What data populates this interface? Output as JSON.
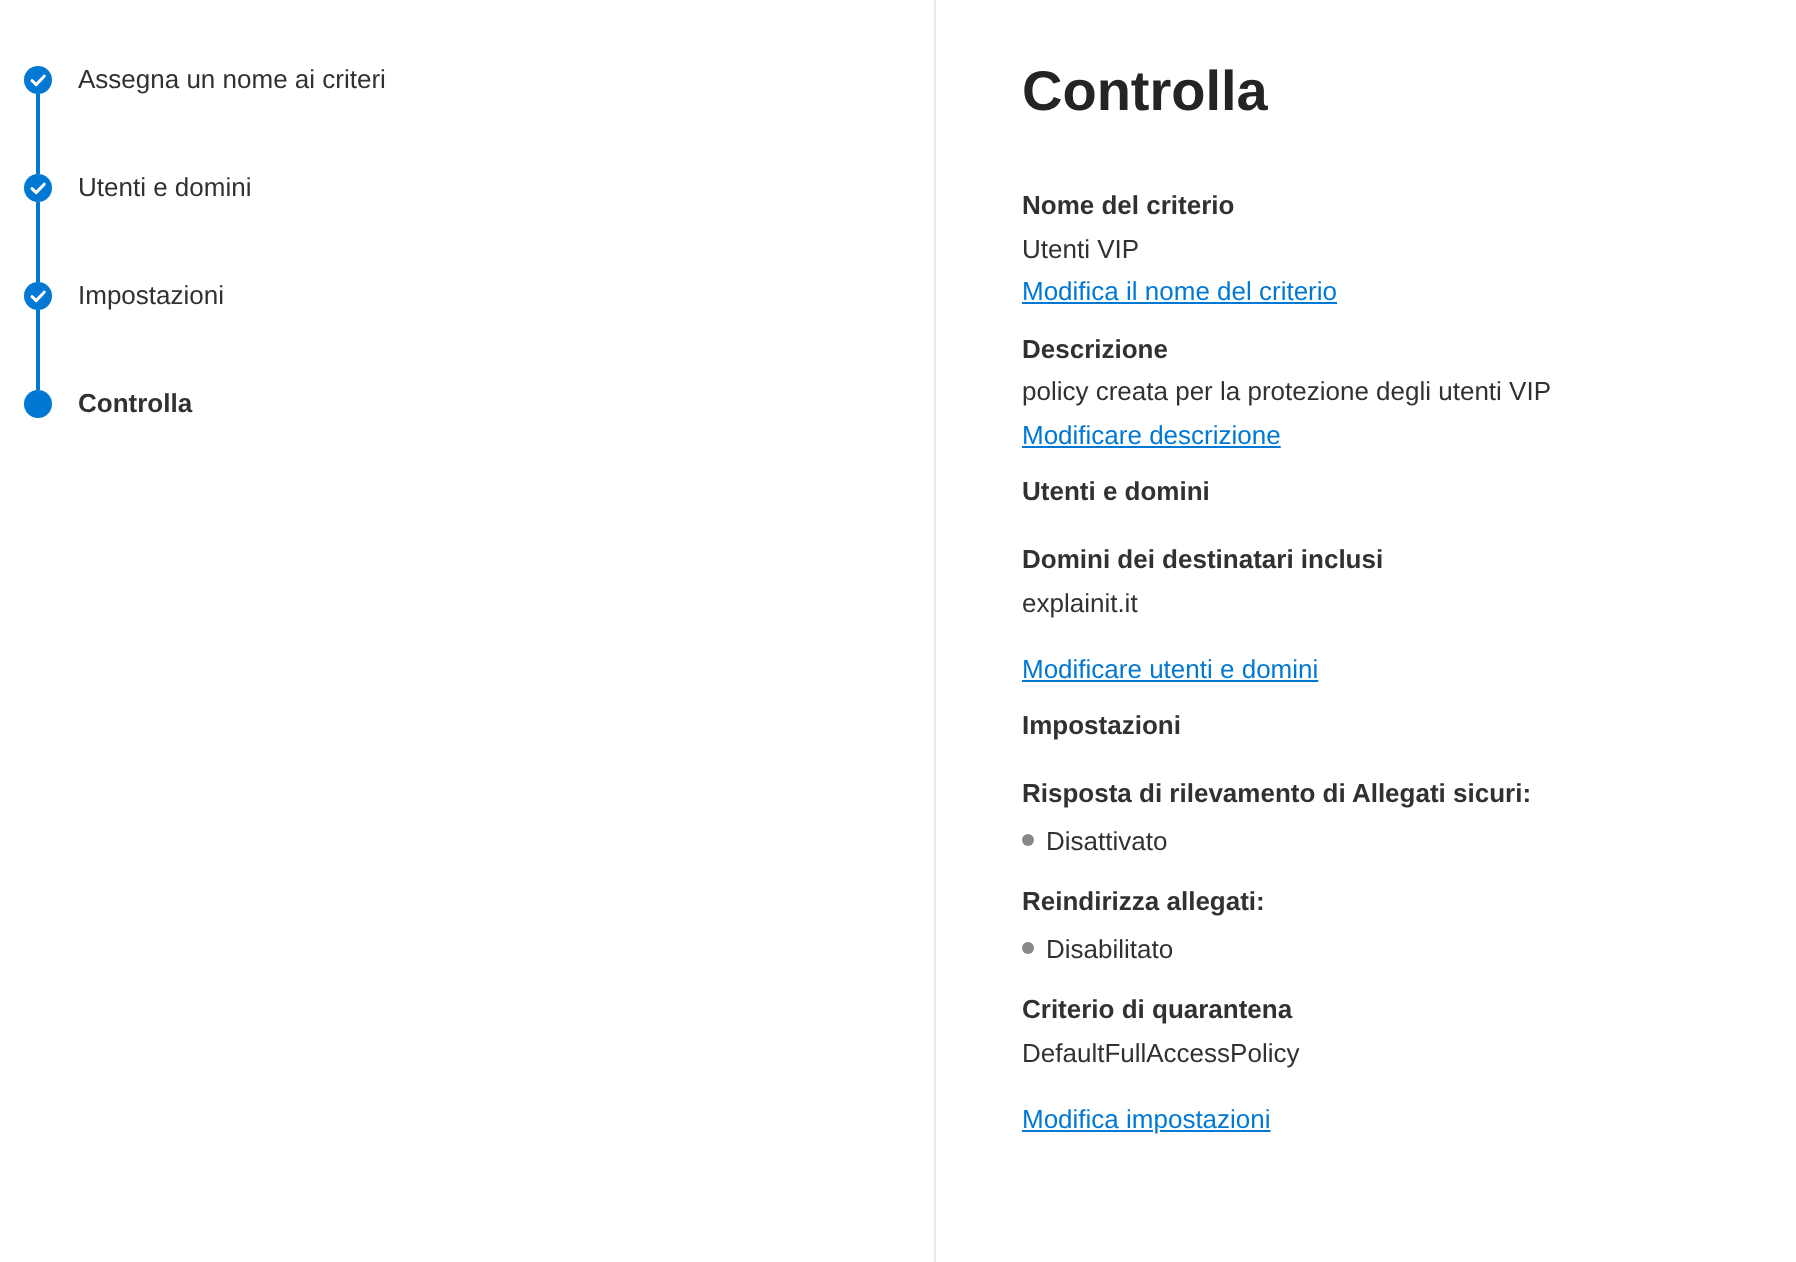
{
  "steps": [
    {
      "label": "Assegna un nome ai criteri",
      "completed": true,
      "selected": false
    },
    {
      "label": "Utenti e domini",
      "completed": true,
      "selected": false
    },
    {
      "label": "Impostazioni",
      "completed": true,
      "selected": false
    },
    {
      "label": "Controlla",
      "completed": false,
      "selected": true
    }
  ],
  "review": {
    "title": "Controlla",
    "sections": [
      {
        "kind": "field",
        "label": "Nome del criterio",
        "value": "Utenti VIP",
        "link": "Modifica il nome del criterio"
      },
      {
        "kind": "field",
        "label": "Descrizione",
        "value": "policy creata per la protezione degli utenti VIP",
        "link": "Modificare descrizione"
      },
      {
        "kind": "heading",
        "label": "Utenti e domini"
      },
      {
        "kind": "field",
        "label": "Domini dei destinatari inclusi",
        "value": "explainit.it"
      },
      {
        "kind": "link",
        "link": "Modificare utenti e domini"
      },
      {
        "kind": "heading",
        "label": "Impostazioni"
      },
      {
        "kind": "status",
        "label": "Risposta di rilevamento di Allegati sicuri:",
        "value": "Disattivato",
        "enabled": false
      },
      {
        "kind": "status",
        "label": "Reindirizza allegati:",
        "value": "Disabilitato",
        "enabled": false
      },
      {
        "kind": "field",
        "label": "Criterio di quarantena",
        "value": "DefaultFullAccessPolicy"
      },
      {
        "kind": "link",
        "link": "Modifica impostazioni"
      }
    ]
  }
}
